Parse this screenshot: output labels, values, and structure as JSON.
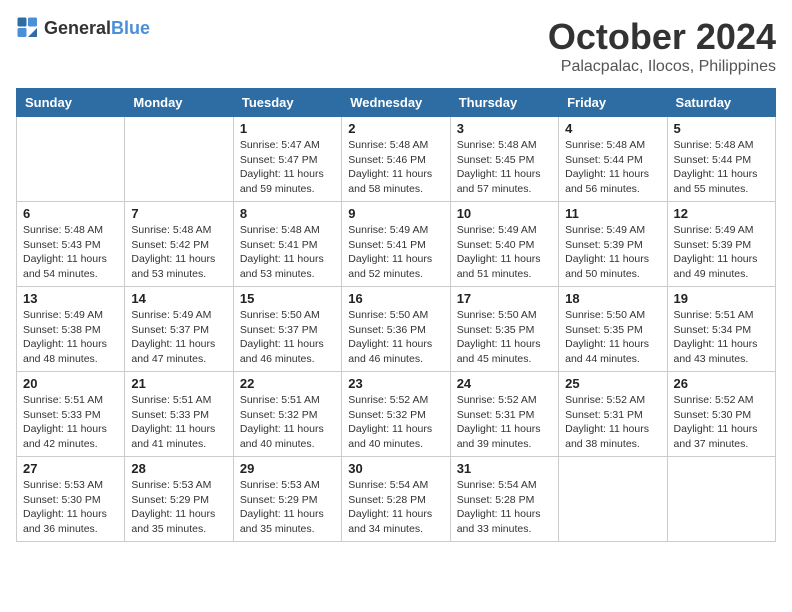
{
  "header": {
    "logo_general": "General",
    "logo_blue": "Blue",
    "month": "October 2024",
    "location": "Palacpalac, Ilocos, Philippines"
  },
  "weekdays": [
    "Sunday",
    "Monday",
    "Tuesday",
    "Wednesday",
    "Thursday",
    "Friday",
    "Saturday"
  ],
  "weeks": [
    [
      {
        "day": "",
        "sunrise": "",
        "sunset": "",
        "daylight": ""
      },
      {
        "day": "",
        "sunrise": "",
        "sunset": "",
        "daylight": ""
      },
      {
        "day": "1",
        "sunrise": "Sunrise: 5:47 AM",
        "sunset": "Sunset: 5:47 PM",
        "daylight": "Daylight: 11 hours and 59 minutes."
      },
      {
        "day": "2",
        "sunrise": "Sunrise: 5:48 AM",
        "sunset": "Sunset: 5:46 PM",
        "daylight": "Daylight: 11 hours and 58 minutes."
      },
      {
        "day": "3",
        "sunrise": "Sunrise: 5:48 AM",
        "sunset": "Sunset: 5:45 PM",
        "daylight": "Daylight: 11 hours and 57 minutes."
      },
      {
        "day": "4",
        "sunrise": "Sunrise: 5:48 AM",
        "sunset": "Sunset: 5:44 PM",
        "daylight": "Daylight: 11 hours and 56 minutes."
      },
      {
        "day": "5",
        "sunrise": "Sunrise: 5:48 AM",
        "sunset": "Sunset: 5:44 PM",
        "daylight": "Daylight: 11 hours and 55 minutes."
      }
    ],
    [
      {
        "day": "6",
        "sunrise": "Sunrise: 5:48 AM",
        "sunset": "Sunset: 5:43 PM",
        "daylight": "Daylight: 11 hours and 54 minutes."
      },
      {
        "day": "7",
        "sunrise": "Sunrise: 5:48 AM",
        "sunset": "Sunset: 5:42 PM",
        "daylight": "Daylight: 11 hours and 53 minutes."
      },
      {
        "day": "8",
        "sunrise": "Sunrise: 5:48 AM",
        "sunset": "Sunset: 5:41 PM",
        "daylight": "Daylight: 11 hours and 53 minutes."
      },
      {
        "day": "9",
        "sunrise": "Sunrise: 5:49 AM",
        "sunset": "Sunset: 5:41 PM",
        "daylight": "Daylight: 11 hours and 52 minutes."
      },
      {
        "day": "10",
        "sunrise": "Sunrise: 5:49 AM",
        "sunset": "Sunset: 5:40 PM",
        "daylight": "Daylight: 11 hours and 51 minutes."
      },
      {
        "day": "11",
        "sunrise": "Sunrise: 5:49 AM",
        "sunset": "Sunset: 5:39 PM",
        "daylight": "Daylight: 11 hours and 50 minutes."
      },
      {
        "day": "12",
        "sunrise": "Sunrise: 5:49 AM",
        "sunset": "Sunset: 5:39 PM",
        "daylight": "Daylight: 11 hours and 49 minutes."
      }
    ],
    [
      {
        "day": "13",
        "sunrise": "Sunrise: 5:49 AM",
        "sunset": "Sunset: 5:38 PM",
        "daylight": "Daylight: 11 hours and 48 minutes."
      },
      {
        "day": "14",
        "sunrise": "Sunrise: 5:49 AM",
        "sunset": "Sunset: 5:37 PM",
        "daylight": "Daylight: 11 hours and 47 minutes."
      },
      {
        "day": "15",
        "sunrise": "Sunrise: 5:50 AM",
        "sunset": "Sunset: 5:37 PM",
        "daylight": "Daylight: 11 hours and 46 minutes."
      },
      {
        "day": "16",
        "sunrise": "Sunrise: 5:50 AM",
        "sunset": "Sunset: 5:36 PM",
        "daylight": "Daylight: 11 hours and 46 minutes."
      },
      {
        "day": "17",
        "sunrise": "Sunrise: 5:50 AM",
        "sunset": "Sunset: 5:35 PM",
        "daylight": "Daylight: 11 hours and 45 minutes."
      },
      {
        "day": "18",
        "sunrise": "Sunrise: 5:50 AM",
        "sunset": "Sunset: 5:35 PM",
        "daylight": "Daylight: 11 hours and 44 minutes."
      },
      {
        "day": "19",
        "sunrise": "Sunrise: 5:51 AM",
        "sunset": "Sunset: 5:34 PM",
        "daylight": "Daylight: 11 hours and 43 minutes."
      }
    ],
    [
      {
        "day": "20",
        "sunrise": "Sunrise: 5:51 AM",
        "sunset": "Sunset: 5:33 PM",
        "daylight": "Daylight: 11 hours and 42 minutes."
      },
      {
        "day": "21",
        "sunrise": "Sunrise: 5:51 AM",
        "sunset": "Sunset: 5:33 PM",
        "daylight": "Daylight: 11 hours and 41 minutes."
      },
      {
        "day": "22",
        "sunrise": "Sunrise: 5:51 AM",
        "sunset": "Sunset: 5:32 PM",
        "daylight": "Daylight: 11 hours and 40 minutes."
      },
      {
        "day": "23",
        "sunrise": "Sunrise: 5:52 AM",
        "sunset": "Sunset: 5:32 PM",
        "daylight": "Daylight: 11 hours and 40 minutes."
      },
      {
        "day": "24",
        "sunrise": "Sunrise: 5:52 AM",
        "sunset": "Sunset: 5:31 PM",
        "daylight": "Daylight: 11 hours and 39 minutes."
      },
      {
        "day": "25",
        "sunrise": "Sunrise: 5:52 AM",
        "sunset": "Sunset: 5:31 PM",
        "daylight": "Daylight: 11 hours and 38 minutes."
      },
      {
        "day": "26",
        "sunrise": "Sunrise: 5:52 AM",
        "sunset": "Sunset: 5:30 PM",
        "daylight": "Daylight: 11 hours and 37 minutes."
      }
    ],
    [
      {
        "day": "27",
        "sunrise": "Sunrise: 5:53 AM",
        "sunset": "Sunset: 5:30 PM",
        "daylight": "Daylight: 11 hours and 36 minutes."
      },
      {
        "day": "28",
        "sunrise": "Sunrise: 5:53 AM",
        "sunset": "Sunset: 5:29 PM",
        "daylight": "Daylight: 11 hours and 35 minutes."
      },
      {
        "day": "29",
        "sunrise": "Sunrise: 5:53 AM",
        "sunset": "Sunset: 5:29 PM",
        "daylight": "Daylight: 11 hours and 35 minutes."
      },
      {
        "day": "30",
        "sunrise": "Sunrise: 5:54 AM",
        "sunset": "Sunset: 5:28 PM",
        "daylight": "Daylight: 11 hours and 34 minutes."
      },
      {
        "day": "31",
        "sunrise": "Sunrise: 5:54 AM",
        "sunset": "Sunset: 5:28 PM",
        "daylight": "Daylight: 11 hours and 33 minutes."
      },
      {
        "day": "",
        "sunrise": "",
        "sunset": "",
        "daylight": ""
      },
      {
        "day": "",
        "sunrise": "",
        "sunset": "",
        "daylight": ""
      }
    ]
  ]
}
